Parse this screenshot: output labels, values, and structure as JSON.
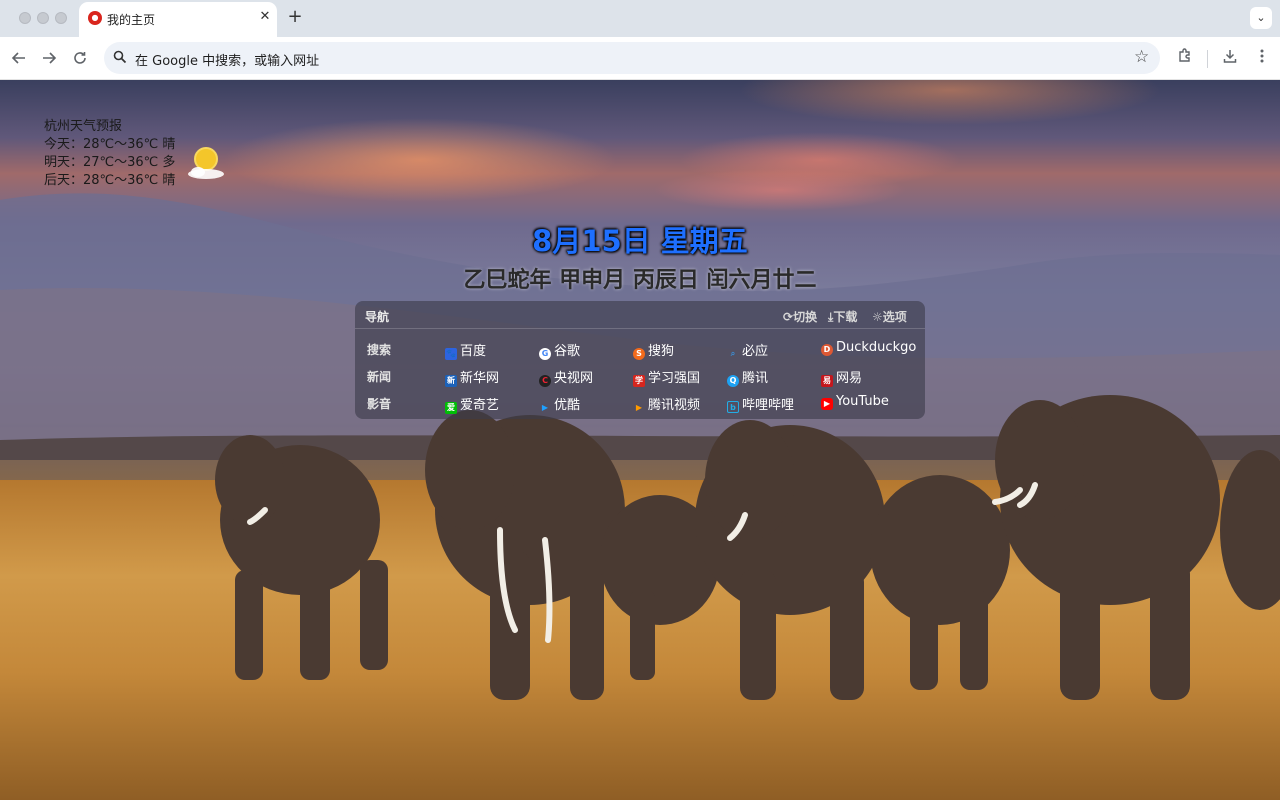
{
  "browser": {
    "tab": {
      "title": "我的主页",
      "close": "✕"
    },
    "new_tab": "+",
    "tab_menu": "⌄",
    "address_bar": {
      "placeholder": "在 Google 中搜索，或输入网址"
    },
    "icons": [
      "back-icon",
      "forward-icon",
      "reload-icon",
      "search-icon",
      "star-icon",
      "extensions-icon",
      "download-icon",
      "menu-icon"
    ]
  },
  "weather": {
    "title": "杭州天气预报",
    "today": "今天：28℃～36℃ 晴",
    "tomorrow": "明天：27℃～36℃ 多",
    "after": "后天：28℃～36℃ 晴",
    "icon": "sun-cloud-icon"
  },
  "date": {
    "solar": "8月15日 星期五",
    "lunar": "乙巳蛇年 甲申月 丙辰日 闰六月廿二"
  },
  "nav": {
    "title": "导航",
    "actions": {
      "switch": "切换",
      "download": "下载",
      "options": "选项"
    },
    "rows": [
      {
        "label": "搜索",
        "sites": [
          "百度",
          "谷歌",
          "搜狗",
          "必应",
          "Duckduckgo"
        ]
      },
      {
        "label": "新闻",
        "sites": [
          "新华网",
          "央视网",
          "学习强国",
          "腾讯",
          "网易"
        ]
      },
      {
        "label": "影音",
        "sites": [
          "爱奇艺",
          "优酷",
          "腾讯视频",
          "哔哩哔哩",
          "YouTube"
        ]
      }
    ]
  },
  "colors": {
    "date": "#1e6fff",
    "panel": "#3c3c4b"
  }
}
